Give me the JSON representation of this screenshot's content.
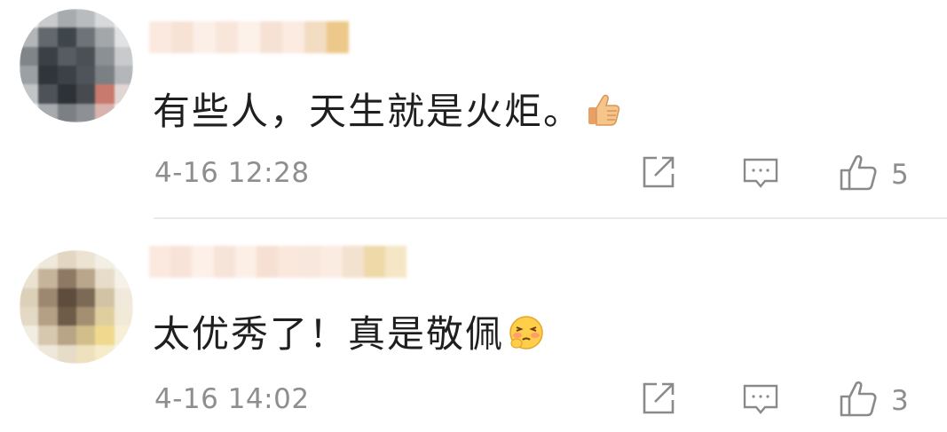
{
  "comments": [
    {
      "text": "有些人，天生就是火炬。",
      "emoji": "thumbs-up",
      "time": "4-16 12:28",
      "likes": "5"
    },
    {
      "text": "太优秀了！真是敬佩",
      "emoji": "blushing-face",
      "time": "4-16 14:02",
      "likes": "3"
    }
  ],
  "icons": {
    "share": "share-icon",
    "reply": "comment-icon",
    "like": "thumbs-up-outline-icon"
  },
  "colors": {
    "text": "#1f1f1f",
    "meta": "#8e8e8e",
    "icon": "#8a8a8a",
    "divider": "#ebebeb"
  }
}
